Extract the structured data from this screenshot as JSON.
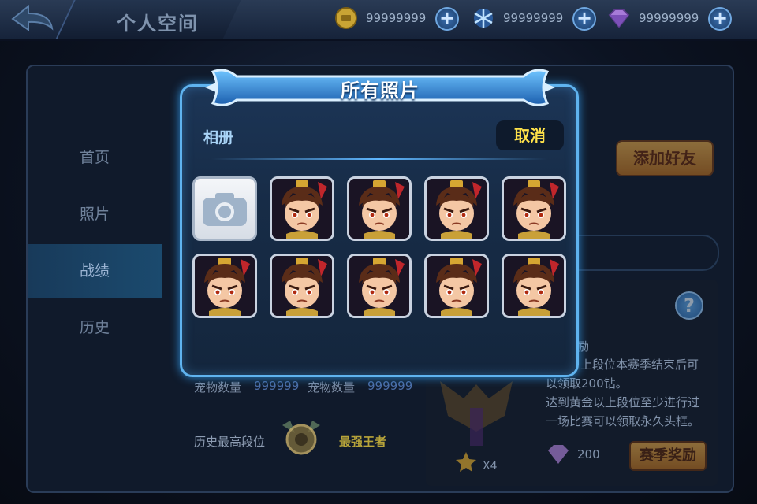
{
  "header": {
    "title": "个人空间",
    "back_icon": "back-arrow-icon"
  },
  "resources": [
    {
      "name": "coin",
      "icon": "gold-coin-icon",
      "value": "99999999",
      "plus": "+"
    },
    {
      "name": "snowflake",
      "icon": "snowflake-icon",
      "value": "99999999",
      "plus": "+"
    },
    {
      "name": "gem",
      "icon": "purple-gem-icon",
      "value": "99999999",
      "plus": "+"
    }
  ],
  "sidebar": {
    "items": [
      {
        "label": "首页",
        "active": false
      },
      {
        "label": "照片",
        "active": false
      },
      {
        "label": "战绩",
        "active": true
      },
      {
        "label": "历史",
        "active": false
      }
    ]
  },
  "background": {
    "add_friend": "添加好友",
    "help": "?",
    "reward_title_fragment": "励",
    "reward_lines": [
      "上段位本赛季结束后可",
      "以领取200钻。",
      "达到黄金以上段位至少进行过",
      "一场比赛可以领取永久头框。"
    ],
    "pet_label_1": "宠物数量",
    "pet_value_1": "999999",
    "pet_label_2": "宠物数量",
    "pet_value_2": "999999",
    "history_rank_label": "历史最高段位",
    "history_rank_value": "最强王者",
    "star_count": "X4",
    "gem_reward": "200",
    "season_reward_button": "赛季奖励"
  },
  "modal": {
    "title": "所有照片",
    "album_label": "相册",
    "cancel_label": "取消",
    "camera_icon": "camera-icon",
    "photo_count": 9
  },
  "colors": {
    "modal_border": "#5fb3ef",
    "cancel_text": "#ffe24a",
    "accent_orange": "#f2b24a"
  }
}
